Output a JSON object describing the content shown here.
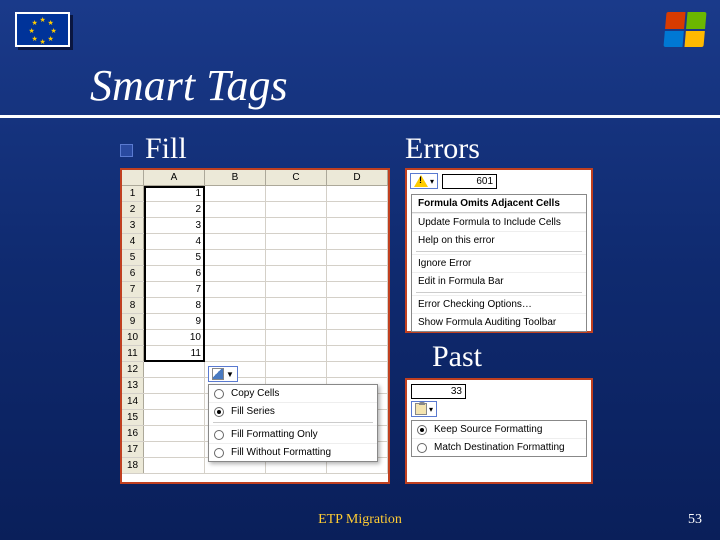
{
  "slide": {
    "title": "Smart Tags",
    "footer": "ETP Migration",
    "number": "53"
  },
  "sections": {
    "fill": "Fill",
    "errors": "Errors",
    "past": "Past"
  },
  "fill_sheet": {
    "cols": [
      "A",
      "B",
      "C",
      "D"
    ],
    "rows": [
      "1",
      "2",
      "3",
      "4",
      "5",
      "6",
      "7",
      "8",
      "9",
      "10",
      "11",
      "12",
      "13",
      "14",
      "15",
      "16",
      "17",
      "18"
    ],
    "colA": [
      "1",
      "2",
      "3",
      "4",
      "5",
      "6",
      "7",
      "8",
      "9",
      "10",
      "11",
      "",
      "",
      "",
      "",
      "",
      "",
      ""
    ]
  },
  "fill_menu": {
    "items": [
      {
        "label": "Copy Cells",
        "selected": false
      },
      {
        "label": "Fill Series",
        "selected": true
      },
      {
        "label": "Fill Formatting Only",
        "selected": false
      },
      {
        "label": "Fill Without Formatting",
        "selected": false
      }
    ]
  },
  "errors_panel": {
    "cell_value": "601",
    "header": "Formula Omits Adjacent Cells",
    "items": [
      "Update Formula to Include Cells",
      "Help on this error",
      "Ignore Error",
      "Edit in Formula Bar",
      "Error Checking Options…",
      "Show Formula Auditing Toolbar"
    ]
  },
  "past_panel": {
    "cell_value": "33",
    "items": [
      {
        "label": "Keep Source Formatting",
        "selected": true
      },
      {
        "label": "Match Destination Formatting",
        "selected": false
      }
    ]
  }
}
